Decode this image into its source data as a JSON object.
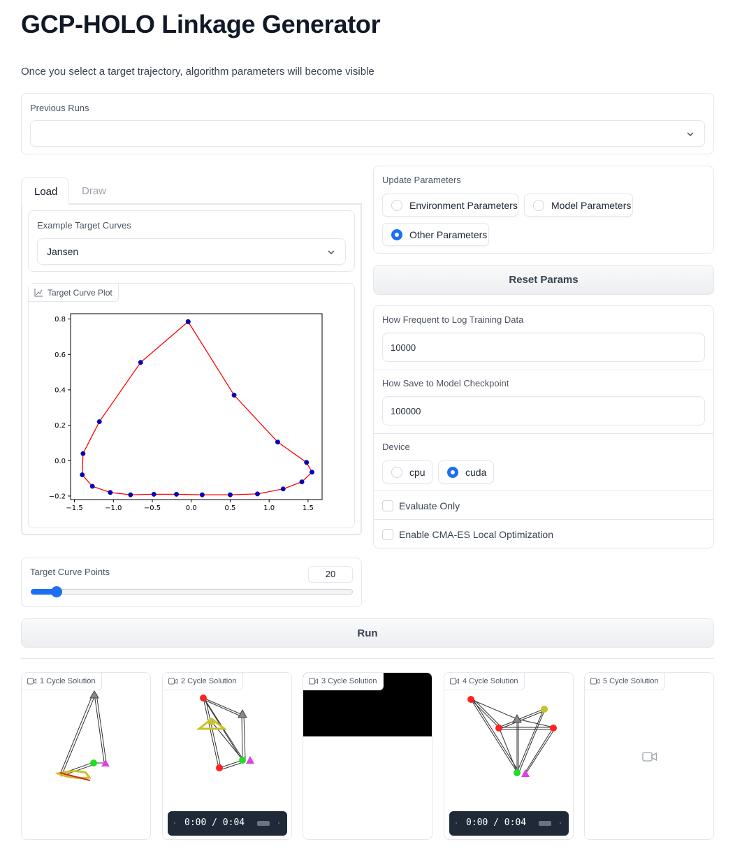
{
  "page": {
    "title": "GCP-HOLO Linkage Generator",
    "subtitle": "Once you select a target trajectory, algorithm parameters will become visible"
  },
  "previous_runs": {
    "label": "Previous Runs",
    "value": ""
  },
  "tabs": [
    {
      "label": "Load",
      "active": true
    },
    {
      "label": "Draw",
      "active": false
    }
  ],
  "example_curves": {
    "label": "Example Target Curves",
    "value": "Jansen"
  },
  "plot": {
    "tag_label": "Target Curve Plot"
  },
  "chart_data": {
    "type": "line",
    "title": "",
    "xlabel": "",
    "ylabel": "",
    "xlim": [
      -1.55,
      1.68
    ],
    "ylim": [
      -0.22,
      0.83
    ],
    "xticks": [
      "−1.5",
      "−1.0",
      "−0.5",
      "0.0",
      "0.5",
      "1.0",
      "1.5"
    ],
    "yticks": [
      "0.8",
      "0.6",
      "0.4",
      "0.2",
      "0.0",
      "−0.2"
    ],
    "xtick_values": [
      -1.5,
      -1.0,
      -0.5,
      0.0,
      0.5,
      1.0,
      1.5
    ],
    "ytick_values": [
      0.8,
      0.6,
      0.4,
      0.2,
      0.0,
      -0.2
    ],
    "line_color": "#ff0000",
    "point_color": "#0000cc",
    "grid": false,
    "series": [
      {
        "points": [
          [
            -0.04,
            0.785
          ],
          [
            0.55,
            0.37
          ],
          [
            1.11,
            0.105
          ],
          [
            1.48,
            -0.01
          ],
          [
            1.55,
            -0.065
          ],
          [
            1.42,
            -0.12
          ],
          [
            1.18,
            -0.16
          ],
          [
            0.85,
            -0.188
          ],
          [
            0.5,
            -0.193
          ],
          [
            0.14,
            -0.193
          ],
          [
            -0.19,
            -0.19
          ],
          [
            -0.48,
            -0.19
          ],
          [
            -0.78,
            -0.193
          ],
          [
            -1.04,
            -0.18
          ],
          [
            -1.27,
            -0.145
          ],
          [
            -1.4,
            -0.08
          ],
          [
            -1.39,
            0.04
          ],
          [
            -1.18,
            0.22
          ],
          [
            -0.65,
            0.555
          ],
          [
            -0.04,
            0.785
          ]
        ]
      }
    ]
  },
  "update_params": {
    "label": "Update Parameters",
    "options": [
      {
        "label": "Environment Parameters",
        "selected": false
      },
      {
        "label": "Model Parameters",
        "selected": false
      },
      {
        "label": "Other Parameters",
        "selected": true
      }
    ]
  },
  "reset_button": "Reset Params",
  "log_freq": {
    "label": "How Frequent to Log Training Data",
    "value": "10000"
  },
  "checkpoint": {
    "label": "How Save to Model Checkpoint",
    "value": "100000"
  },
  "device": {
    "label": "Device",
    "options": [
      {
        "label": "cpu",
        "selected": false
      },
      {
        "label": "cuda",
        "selected": true
      }
    ]
  },
  "evaluate_only": {
    "label": "Evaluate Only",
    "checked": false
  },
  "cma_es": {
    "label": "Enable CMA-ES Local Optimization",
    "checked": false
  },
  "curve_points": {
    "label": "Target Curve Points",
    "value": "20",
    "fraction": 0.08
  },
  "run_button": "Run",
  "videos": [
    {
      "label": "1 Cycle Solution",
      "state": "frame"
    },
    {
      "label": "2 Cycle Solution",
      "state": "frame",
      "time": "0:00 / 0:04"
    },
    {
      "label": "3 Cycle Solution",
      "state": "black"
    },
    {
      "label": "4 Cycle Solution",
      "state": "frame",
      "time": "0:00 / 0:04"
    },
    {
      "label": "5 Cycle Solution",
      "state": "empty"
    }
  ],
  "colors": {
    "accent": "#1d6ff2",
    "border": "#e5e7eb",
    "player": "#1f2937"
  }
}
